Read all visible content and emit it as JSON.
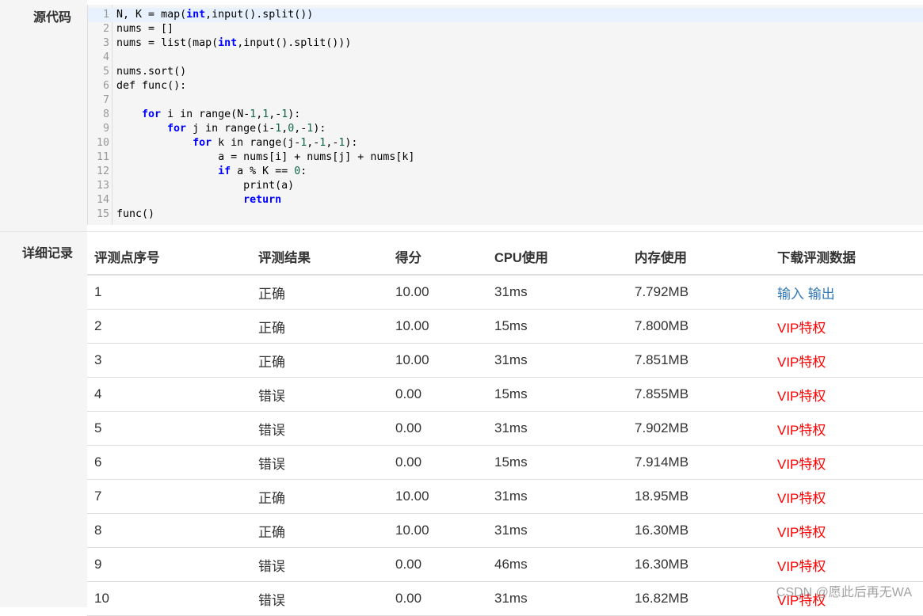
{
  "source_section": {
    "label": "源代码",
    "lines": [
      "N, K = map(int,input().split())",
      "nums = []",
      "nums = list(map(int,input().split()))",
      "",
      "nums.sort()",
      "def func():",
      "",
      "    for i in range(N-1,1,-1):",
      "        for j in range(i-1,0,-1):",
      "            for k in range(j-1,-1,-1):",
      "                a = nums[i] + nums[j] + nums[k]",
      "                if a % K == 0:",
      "                    print(a)",
      "                    return",
      "func()"
    ]
  },
  "detail_section": {
    "label": "详细记录",
    "headers": [
      "评测点序号",
      "评测结果",
      "得分",
      "CPU使用",
      "内存使用",
      "下载评测数据"
    ],
    "rows": [
      {
        "index": "1",
        "result": "正确",
        "score": "10.00",
        "cpu": "31ms",
        "memory": "7.792MB",
        "download": [
          "输入",
          "输出"
        ]
      },
      {
        "index": "2",
        "result": "正确",
        "score": "10.00",
        "cpu": "15ms",
        "memory": "7.800MB",
        "download": "VIP特权"
      },
      {
        "index": "3",
        "result": "正确",
        "score": "10.00",
        "cpu": "31ms",
        "memory": "7.851MB",
        "download": "VIP特权"
      },
      {
        "index": "4",
        "result": "错误",
        "score": "0.00",
        "cpu": "15ms",
        "memory": "7.855MB",
        "download": "VIP特权"
      },
      {
        "index": "5",
        "result": "错误",
        "score": "0.00",
        "cpu": "31ms",
        "memory": "7.902MB",
        "download": "VIP特权"
      },
      {
        "index": "6",
        "result": "错误",
        "score": "0.00",
        "cpu": "15ms",
        "memory": "7.914MB",
        "download": "VIP特权"
      },
      {
        "index": "7",
        "result": "正确",
        "score": "10.00",
        "cpu": "31ms",
        "memory": "18.95MB",
        "download": "VIP特权"
      },
      {
        "index": "8",
        "result": "正确",
        "score": "10.00",
        "cpu": "31ms",
        "memory": "16.30MB",
        "download": "VIP特权"
      },
      {
        "index": "9",
        "result": "错误",
        "score": "0.00",
        "cpu": "46ms",
        "memory": "16.30MB",
        "download": "VIP特权"
      },
      {
        "index": "10",
        "result": "错误",
        "score": "0.00",
        "cpu": "31ms",
        "memory": "16.82MB",
        "download": "VIP特权"
      }
    ]
  },
  "watermark": "CSDN @愿此后再无WA",
  "colors": {
    "link": "#337ab7",
    "vip": "#ff0000",
    "keyword": "#0000ff",
    "number": "#116644"
  }
}
